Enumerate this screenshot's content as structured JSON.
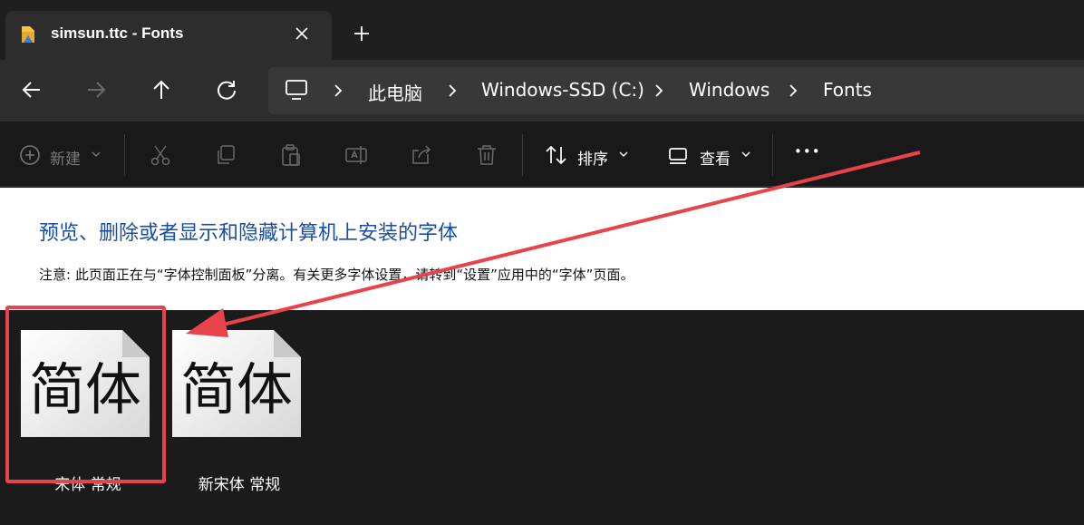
{
  "tab": {
    "title": "simsun.ttc - Fonts",
    "icon": "folder-icon"
  },
  "nav": {
    "back": "arrow-left-icon",
    "forward": "arrow-right-icon",
    "up": "arrow-up-icon",
    "refresh": "refresh-icon"
  },
  "breadcrumb": {
    "items": [
      "此电脑",
      "Windows-SSD (C:)",
      "Windows",
      "Fonts"
    ]
  },
  "commands": {
    "new_label": "新建",
    "sort_label": "排序",
    "view_label": "查看",
    "more_label": "•••"
  },
  "header": {
    "heading": "预览、删除或者显示和隐藏计算机上安装的字体",
    "note": "注意: 此页面正在与“字体控制面板”分离。有关更多字体设置，请转到“设置”应用中的“字体”页面。"
  },
  "fonts": [
    {
      "preview": "简体",
      "label": "宋体 常规",
      "selected": true
    },
    {
      "preview": "简体",
      "label": "新宋体 常规",
      "selected": false
    }
  ],
  "colors": {
    "accent_link": "#1a4fa0",
    "annotation_red": "#e8434a"
  }
}
